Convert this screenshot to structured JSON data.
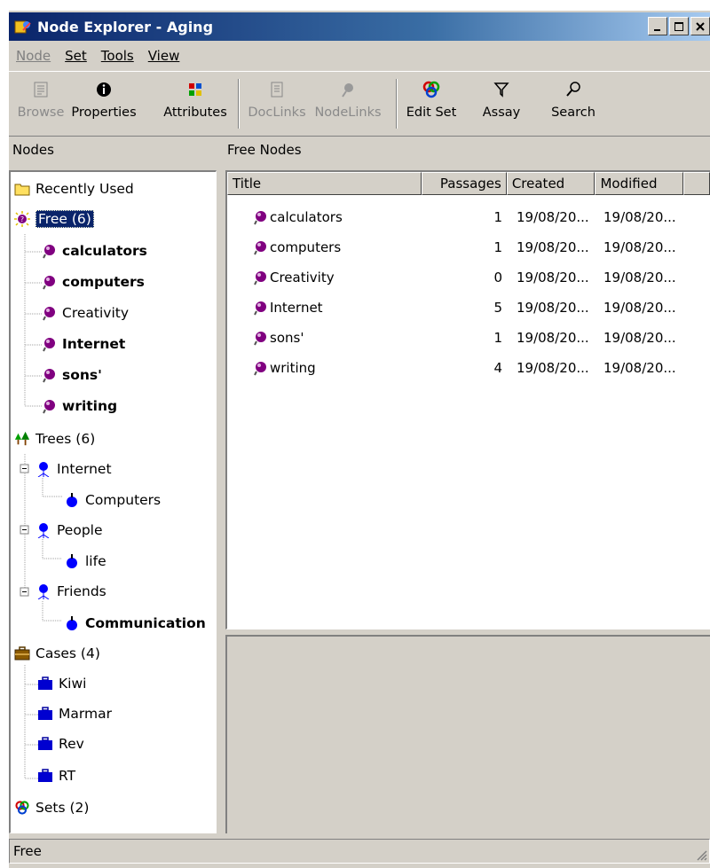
{
  "window": {
    "title": "Node Explorer - Aging",
    "controls": [
      "_",
      "□",
      "X"
    ]
  },
  "menu": [
    {
      "label": "Node",
      "disabled": true
    },
    {
      "label": "Set",
      "disabled": false
    },
    {
      "label": "Tools",
      "disabled": false
    },
    {
      "label": "View",
      "disabled": false
    }
  ],
  "toolbar": {
    "browse": "Browse",
    "properties": "Properties",
    "attributes": "Attributes",
    "doclinks": "DocLinks",
    "nodelinks": "NodeLinks",
    "edit_set": "Edit Set",
    "assay": "Assay",
    "search": "Search"
  },
  "left_header": "Nodes",
  "right_header": "Free Nodes",
  "tree": {
    "recently_used": "Recently Used",
    "free": "Free (6)",
    "free_nodes": [
      "calculators",
      "computers",
      "Creativity",
      "Internet",
      "sons'",
      "writing"
    ],
    "trees": "Trees (6)",
    "tree_internet": "Internet",
    "tree_computers": "Computers",
    "tree_people": "People",
    "tree_life": "life",
    "tree_friends": "Friends",
    "tree_communication": "Communication",
    "cases": "Cases (4)",
    "case_items": [
      "Kiwi",
      "Marmar",
      "Rev",
      "RT"
    ],
    "sets": "Sets (2)"
  },
  "list": {
    "columns": [
      "Title",
      "Passages",
      "Created",
      "Modified"
    ],
    "rows": [
      {
        "title": "calculators",
        "passages": "1",
        "created": "19/08/20...",
        "modified": "19/08/20..."
      },
      {
        "title": "computers",
        "passages": "1",
        "created": "19/08/20...",
        "modified": "19/08/20..."
      },
      {
        "title": "Creativity",
        "passages": "0",
        "created": "19/08/20...",
        "modified": "19/08/20..."
      },
      {
        "title": "Internet",
        "passages": "5",
        "created": "19/08/20...",
        "modified": "19/08/20..."
      },
      {
        "title": "sons'",
        "passages": "1",
        "created": "19/08/20...",
        "modified": "19/08/20..."
      },
      {
        "title": "writing",
        "passages": "4",
        "created": "19/08/20...",
        "modified": "19/08/20..."
      }
    ]
  },
  "status": "Free",
  "colors": {
    "titlebar": "#0a246a",
    "selection": "#0a246a",
    "node_purple": "#800080",
    "tree_blue": "#0000ff",
    "case_brown": "#8b5a00"
  }
}
